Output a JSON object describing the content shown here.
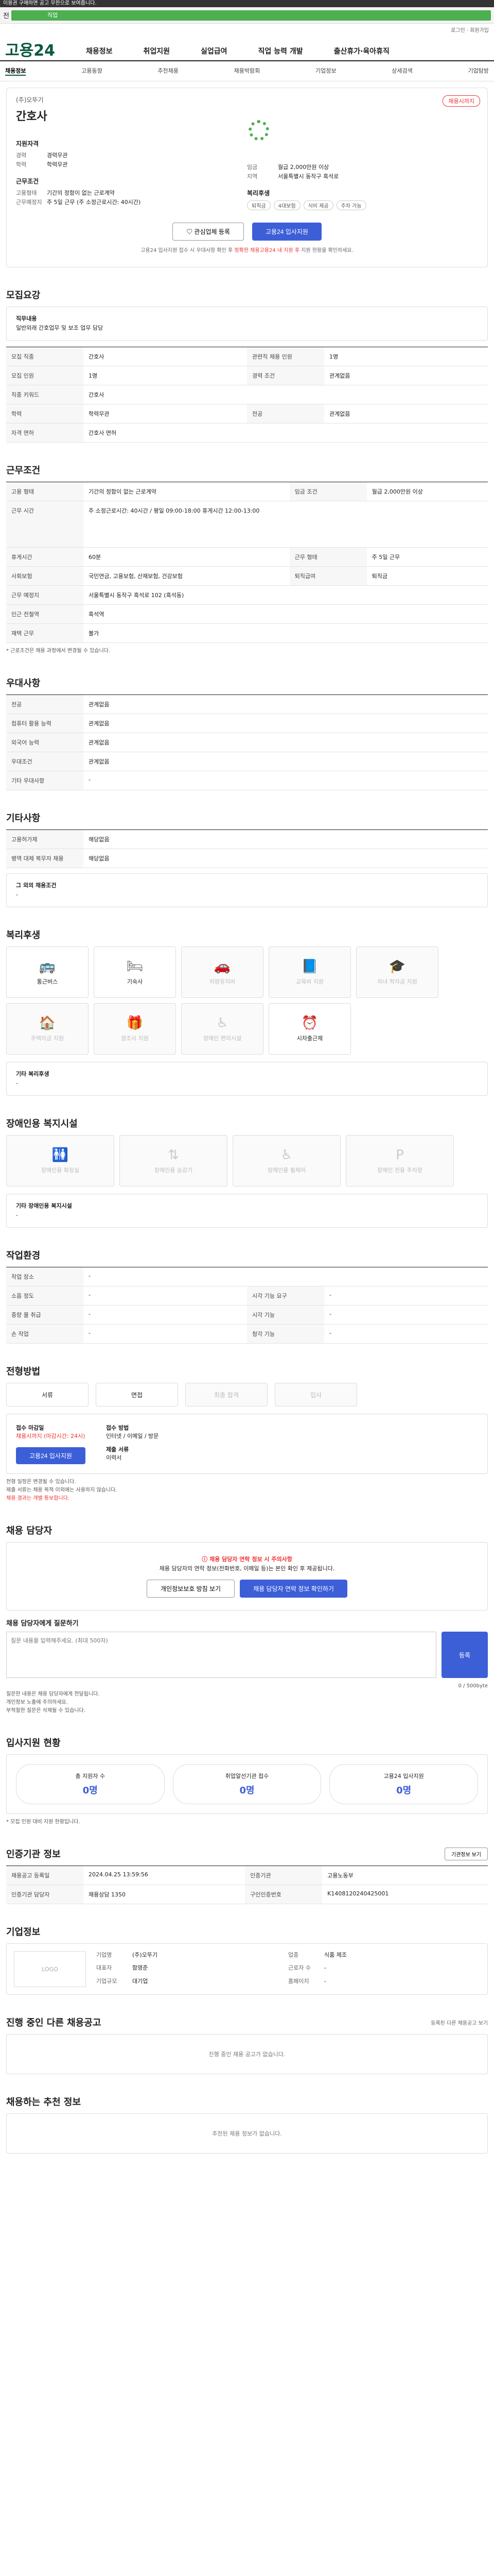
{
  "top_notice": "이용권 구매하면 공고 무한으로 보여줍니다.",
  "search": {
    "left_label": "전",
    "tag": "직업"
  },
  "login": "로그인 · 회원가입",
  "logo": "고용24",
  "gnb": [
    "채용정보",
    "취업지원",
    "실업급여",
    "직업 능력 개발",
    "출산휴가·육아휴직"
  ],
  "subnav": [
    "채용정보",
    "고용동향",
    "추천채용",
    "채용박람회",
    "기업정보",
    "상세검색",
    "기업탐방"
  ],
  "hero": {
    "company": "(주)오뚜기",
    "title": "간호사",
    "badge": "채용시까지",
    "recruit_title": "지원자격",
    "kv": [
      [
        "경력",
        "경력무관"
      ],
      [
        "학력",
        "학력무관"
      ]
    ],
    "cond_title": "근무조건",
    "cond": [
      [
        "고용형태",
        "기간의 정함이 없는 근로계약"
      ],
      [
        "근무예정지",
        "주 5일 근무 (주 소정근로시간: 40시간)"
      ]
    ],
    "right_kv": [
      [
        "임금",
        "월급 2,000만원 이상"
      ],
      [
        "지역",
        "서울특별시 동작구 흑석로"
      ]
    ],
    "welfare_title": "복리후생",
    "chips": [
      "퇴직금",
      "4대보험",
      "식비 제공",
      "주차 가능"
    ],
    "btn_interest": "관심업체 등록",
    "btn_apply": "고용24 입사지원",
    "note_pre": "고용24 입사지원 접수 시 우대사항 확인 후 ",
    "note_red": "정확한 채용고용24 내 지원 후",
    "note_post": " 지원 현황을 확인하세요."
  },
  "sec1": {
    "title": "모집요강",
    "sub": "직무내용",
    "body": "일반외래 간호업무 및 보조 업무 담당",
    "rows": [
      [
        "모집 직종",
        "간호사",
        "관련직 채용 인원",
        "1명"
      ],
      [
        "모집 인원",
        "1명",
        "경력 조건",
        "관계없음"
      ],
      [
        "직종 키워드",
        "간호사",
        "",
        ""
      ],
      [
        "학력",
        "학력무관",
        "전공",
        "관계없음"
      ],
      [
        "자격 면허",
        "간호사 면허",
        "",
        ""
      ]
    ]
  },
  "sec2": {
    "title": "근무조건",
    "rows": [
      [
        "고용 형태",
        "기간의 정함이 없는 근로계약",
        "임금 조건",
        "월급 2,000만원 이상"
      ],
      [
        "근무 시간",
        "주 소정근로시간: 40시간 / 평일 09:00-18:00 휴게시간 12:00-13:00",
        "",
        ""
      ],
      [
        "휴게시간",
        "60분",
        "근무 형태",
        "주 5일 근무"
      ],
      [
        "사회보험",
        "국민연금, 고용보험, 산재보험, 건강보험",
        "퇴직급여",
        "퇴직금"
      ],
      [
        "근무 예정지",
        "서울특별시 동작구 흑석로 102 (흑석동)",
        "",
        ""
      ],
      [
        "인근 전철역",
        "흑석역",
        "",
        ""
      ],
      [
        "재택 근무",
        "불가",
        "",
        ""
      ]
    ],
    "note": "* 근로조건은 채용 과정에서 변경될 수 있습니다."
  },
  "sec3": {
    "title": "우대사항",
    "rows": [
      [
        "전공",
        "관계없음"
      ],
      [
        "컴퓨터 활용 능력",
        "관계없음"
      ],
      [
        "외국어 능력",
        "관계없음"
      ],
      [
        "우대조건",
        "관계없음"
      ],
      [
        "기타 우대사항",
        "-"
      ]
    ]
  },
  "sec4": {
    "title": "기타사항",
    "rows": [
      [
        "고용허가제",
        "해당없음"
      ],
      [
        "병역 대체 복무자 채용",
        "해당없음"
      ]
    ],
    "other_title": "그 외의 채용조건",
    "other": "-"
  },
  "sec5": {
    "title": "복리후생",
    "cards": [
      [
        "통근버스",
        true
      ],
      [
        "기숙사",
        true
      ],
      [
        "차량유지비",
        false
      ],
      [
        "교육비 지원",
        false
      ],
      [
        "자녀 학자금 지원",
        false
      ],
      [
        "주택자금 지원",
        false
      ],
      [
        "경조사 지원",
        false
      ],
      [
        "장애인 편의시설",
        false
      ],
      [
        "시차출근제",
        true
      ]
    ],
    "other_title": "기타 복리후생",
    "other": "-"
  },
  "sec6": {
    "title": "장애인용 복지시설",
    "cards": [
      "장애인용 화장실",
      "장애인용 승강기",
      "장애인용 휠체어",
      "장애인 전용 주차장"
    ],
    "other_title": "기타 장애인용 복지시설",
    "other": "-"
  },
  "sec7": {
    "title": "작업환경",
    "rows": [
      [
        "작업 장소",
        "-",
        "",
        ""
      ],
      [
        "소음 정도",
        "-",
        "시각 기능 요구",
        "-"
      ],
      [
        "중량 물 취급",
        "-",
        "시각 기능",
        "-"
      ],
      [
        "손 작업",
        "-",
        "청각 기능",
        "-"
      ]
    ]
  },
  "sec8": {
    "title": "전형방법",
    "steps": [
      "서류",
      "면접",
      "최종 합격",
      "입사"
    ],
    "notes": [
      "전형 일정은 변경될 수 있습니다.",
      "제출 서류는 채용 목적 이외에는 사용하지 않습니다.",
      "채용 결과는 개별 통보합니다."
    ],
    "apply": {
      "period_label": "접수 마감일",
      "period": "채용시까지 (마감시간: 24시)",
      "method_label": "접수 방법",
      "method": "인터넷 / 이메일 / 방문",
      "doc_label": "제출 서류",
      "doc": "이력서",
      "btn": "고용24 입사지원"
    }
  },
  "contact": {
    "title": "채용 담당자",
    "alert": "채용 담당자 연락 정보 시 주의사항",
    "body": "채용 담당자의 연락 정보(전화번호, 이메일 등)는 본인 확인 후 제공됩니다.",
    "btn1": "개인정보보호 방침 보기",
    "btn2": "채용 담당자 연락 정보 확인하기"
  },
  "qna": {
    "title": "채용 담당자에게 질문하기",
    "placeholder": "질문 내용을 입력해주세요. (최대 500자)",
    "btn": "등록",
    "count": "0 / 500byte",
    "notes": [
      "질문한 내용은 채용 담당자에게 전달됩니다.",
      "개인정보 노출에 주의하세요.",
      "부적절한 질문은 삭제될 수 있습니다."
    ]
  },
  "stats": {
    "title": "입사지원 현황",
    "items": [
      [
        "총 지원자 수",
        "0명"
      ],
      [
        "취업알선기관 접수",
        "0명"
      ],
      [
        "고용24 입사지원",
        "0명"
      ]
    ],
    "note": "* 모집 인원 대비 지원 현황입니다."
  },
  "info": {
    "title": "인증기관 정보",
    "btn": "기관정보 보기",
    "rows": [
      [
        "채용공고 등록일",
        "2024.04.25 13:59:56",
        "인증기관",
        "고용노동부"
      ],
      [
        "인증기관 담당자",
        "채용상담 1350",
        "구인인증번호",
        "K1408120240425001"
      ]
    ]
  },
  "corp": {
    "title": "기업정보",
    "logo": "LOGO",
    "rows": [
      [
        "기업명",
        "(주)오뚜기",
        "업종",
        "식품 제조"
      ],
      [
        "대표자",
        "함영준",
        "근로자 수",
        "-"
      ],
      [
        "기업규모",
        "대기업",
        "홈페이지",
        "-"
      ]
    ]
  },
  "other_jobs": {
    "title": "진행 중인 다른 채용공고",
    "right": "등록된 다른 채용공고 보기",
    "empty": "진행 중인 채용 공고가 없습니다."
  },
  "rec": {
    "title": "채용하는 추천 정보",
    "empty": "추천된 채용 정보가 없습니다."
  }
}
